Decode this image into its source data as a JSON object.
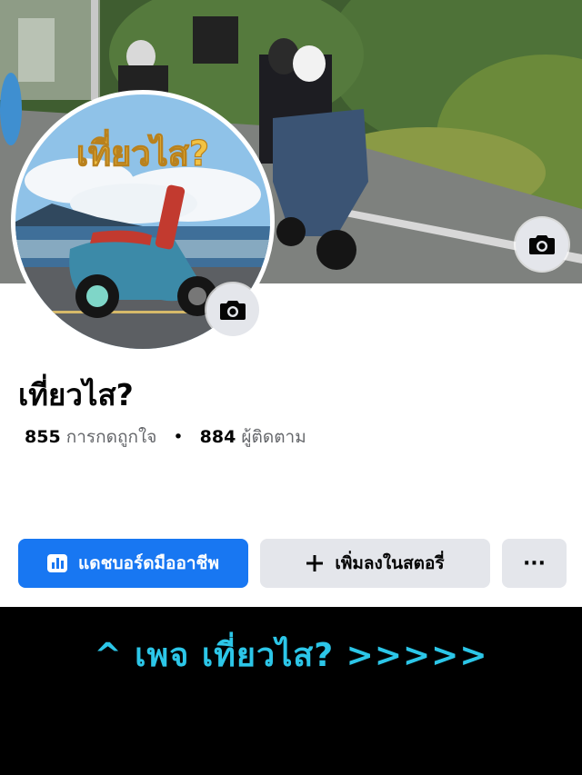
{
  "page": {
    "name": "เที่ยวไส?",
    "likes_count": "855",
    "likes_label": "การกดถูกใจ",
    "separator": "•",
    "followers_count": "884",
    "followers_label": "ผู้ติดตาม"
  },
  "avatar": {
    "logo_text": "เที่ยวไส?"
  },
  "actions": {
    "dashboard_label": "แดชบอร์ดมืออาชีพ",
    "add_story_label": "เพิ่มลงในสตอรี่",
    "more_label": "···"
  },
  "caption": {
    "text": "^ เพจ เที่ยวไส? >>>>>"
  },
  "colors": {
    "primary": "#1877f2",
    "secondary_bg": "#e4e6eb",
    "caption": "#2cc6e8"
  },
  "icons": {
    "cover_camera": "camera-icon",
    "profile_camera": "camera-icon",
    "dashboard": "bar-chart-icon",
    "add": "plus-icon",
    "more": "more-dots-icon"
  }
}
